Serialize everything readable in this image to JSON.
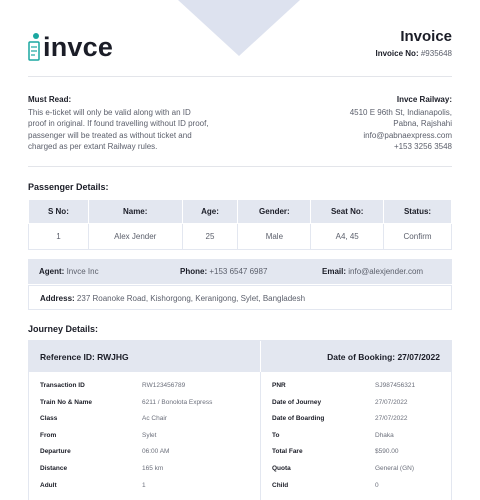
{
  "logo": {
    "text": "invce"
  },
  "invoice": {
    "title": "Invoice",
    "no_label": "Invoice No:",
    "no_value": "#935648"
  },
  "must_read": {
    "heading": "Must Read:",
    "lines": [
      "This e-ticket will only be valid along with an ID",
      "proof in original. If found travelling without ID proof,",
      "passenger will be treated as without ticket and",
      "charged as per extant Railway rules."
    ]
  },
  "railway": {
    "heading": "Invce Railway:",
    "lines": [
      "4510 E 96th St, Indianapolis,",
      "Pabna, Rajshahi",
      "info@pabnaexpress.com",
      "+153 3256 3548"
    ]
  },
  "passenger": {
    "title": "Passenger Details:",
    "headers": [
      "S No:",
      "Name:",
      "Age:",
      "Gender:",
      "Seat No:",
      "Status:"
    ],
    "row": [
      "1",
      "Alex Jender",
      "25",
      "Male",
      "A4, 45",
      "Confirm"
    ]
  },
  "agent": {
    "agent_label": "Agent:",
    "agent_value": "Invce Inc",
    "phone_label": "Phone:",
    "phone_value": "+153 6547 6987",
    "email_label": "Email:",
    "email_value": "info@alexjender.com",
    "address_label": "Address:",
    "address_value": "237 Roanoke Road, Kishorgong, Kerani​gong, Sylet, Bangladesh"
  },
  "journey": {
    "title": "Journey Details:",
    "reference": "Reference ID: RWJHG",
    "booking_date": "Date of Booking: 27/07/2022",
    "rows": [
      {
        "lk": "Transaction ID",
        "lv": "RW123456789",
        "rk": "PNR",
        "rv": "SJ987456321"
      },
      {
        "lk": "Train No & Name",
        "lv": "6211 / Bonolota Express",
        "rk": "Date of Journey",
        "rv": "27/07/2022"
      },
      {
        "lk": "Class",
        "lv": "Ac Chair",
        "rk": "Date of Boarding",
        "rv": "27/07/2022"
      },
      {
        "lk": "From",
        "lv": "Sylet",
        "rk": "To",
        "rv": "Dhaka"
      },
      {
        "lk": "Departure",
        "lv": "06:00 AM",
        "rk": "Total Fare",
        "rv": "$590.00"
      },
      {
        "lk": "Distance",
        "lv": "165 km",
        "rk": "Quota",
        "rv": "General (GN)"
      },
      {
        "lk": "Adult",
        "lv": "1",
        "rk": "Child",
        "rv": "0"
      }
    ]
  }
}
